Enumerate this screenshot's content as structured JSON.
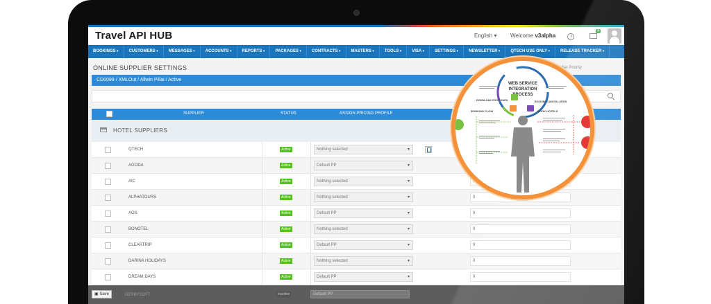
{
  "app": {
    "title": "Travel API HUB",
    "language": "English",
    "welcome_prefix": "Welcome",
    "username": "v3alpha",
    "mail_count": "4"
  },
  "nav": [
    "BOOKINGS",
    "CUSTOMERS",
    "MESSAGES",
    "ACCOUNTS",
    "REPORTS",
    "PACKAGES",
    "CONTRACTS",
    "MASTERS",
    "TOOLS",
    "VISA",
    "SETTINGS",
    "NEWSLETTER",
    "QTECH USE ONLY",
    "RELEASE TRACKER"
  ],
  "page": {
    "title": "ONLINE SUPPLIER SETTINGS",
    "breadcrumb": "arch Agent  /  Set Priority",
    "info": "CD0099 / XMLOut / Allwin Pillai / Active"
  },
  "table": {
    "columns": {
      "supplier": "SUPPLIER",
      "status": "STATUS",
      "profile": "ASSIGN PRICING PROFILE"
    },
    "section": "HOTEL SUPPLIERS",
    "rows": [
      {
        "name": "QTECH",
        "status": "Active",
        "profile": "Nothing selected",
        "value": ""
      },
      {
        "name": "AGODA",
        "status": "Active",
        "profile": "Default PP",
        "value": ""
      },
      {
        "name": "AIC",
        "status": "Active",
        "profile": "Nothing selected",
        "value": "0"
      },
      {
        "name": "ALPHATOURS",
        "status": "Active",
        "profile": "Nothing selected",
        "value": "0"
      },
      {
        "name": "AOS",
        "status": "Active",
        "profile": "Default PP",
        "value": "0"
      },
      {
        "name": "BONOTEL",
        "status": "Active",
        "profile": "Nothing selected",
        "value": "0"
      },
      {
        "name": "CLEARTRIP",
        "status": "Active",
        "profile": "Default PP",
        "value": "0"
      },
      {
        "name": "DARINA HOLIDAYS",
        "status": "Active",
        "profile": "Nothing selected",
        "value": "0"
      },
      {
        "name": "DREAM DAYS",
        "status": "Active",
        "profile": "Default PP",
        "value": "0"
      }
    ],
    "ghost_row": {
      "name": "DERBYSOFT",
      "status": "Inactive",
      "profile": "Default PP"
    }
  },
  "footer": {
    "save_label": "Save"
  },
  "lens": {
    "title_line1": "WEB SERVICE",
    "title_line2": "INTEGRATION",
    "title_line3": "PROCESS",
    "labels": [
      "BOOKING FLOW",
      "BOOK HOTELS",
      "DOWNLOAD STATIC DATA",
      "BOOKING CANCELLATION"
    ]
  },
  "colors": {
    "brand_blue": "#1b75bb",
    "table_blue": "#2c8ad6",
    "active_green": "#53c21d",
    "lens_orange": "#f3923a"
  }
}
